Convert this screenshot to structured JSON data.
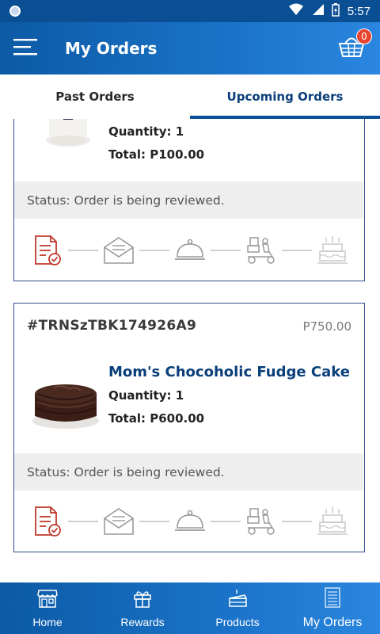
{
  "status_bar": {
    "time": "5:57"
  },
  "header": {
    "title": "My Orders",
    "cart_count": "0"
  },
  "tabs": [
    {
      "label": "Past Orders"
    },
    {
      "label": "Upcoming Orders"
    }
  ],
  "orders": [
    {
      "quantity": "Quantity: 1",
      "total": "Total: P100.00",
      "status": "Status: Order is being reviewed."
    },
    {
      "transaction_id": "#TRNSzTBK174926A9",
      "price": "P750.00",
      "product_name": "Mom's Chocoholic Fudge Cake",
      "quantity": "Quantity: 1",
      "total": "Total: P600.00",
      "status": "Status: Order is being reviewed."
    }
  ],
  "progress_steps": [
    "order-reviewed-icon",
    "confirmation-envelope-icon",
    "preparing-cloche-icon",
    "delivery-scooter-icon",
    "cake-ready-icon"
  ],
  "bottom_nav": [
    {
      "label": "Home",
      "icon": "store-icon"
    },
    {
      "label": "Rewards",
      "icon": "gift-icon"
    },
    {
      "label": "Products",
      "icon": "cake-slice-icon"
    },
    {
      "label": "My Orders",
      "icon": "receipt-icon"
    }
  ],
  "colors": {
    "primary": "#0c5aa5",
    "accent_red": "#c0392b",
    "badge": "#e8432e",
    "product_title": "#0a3f7a"
  }
}
